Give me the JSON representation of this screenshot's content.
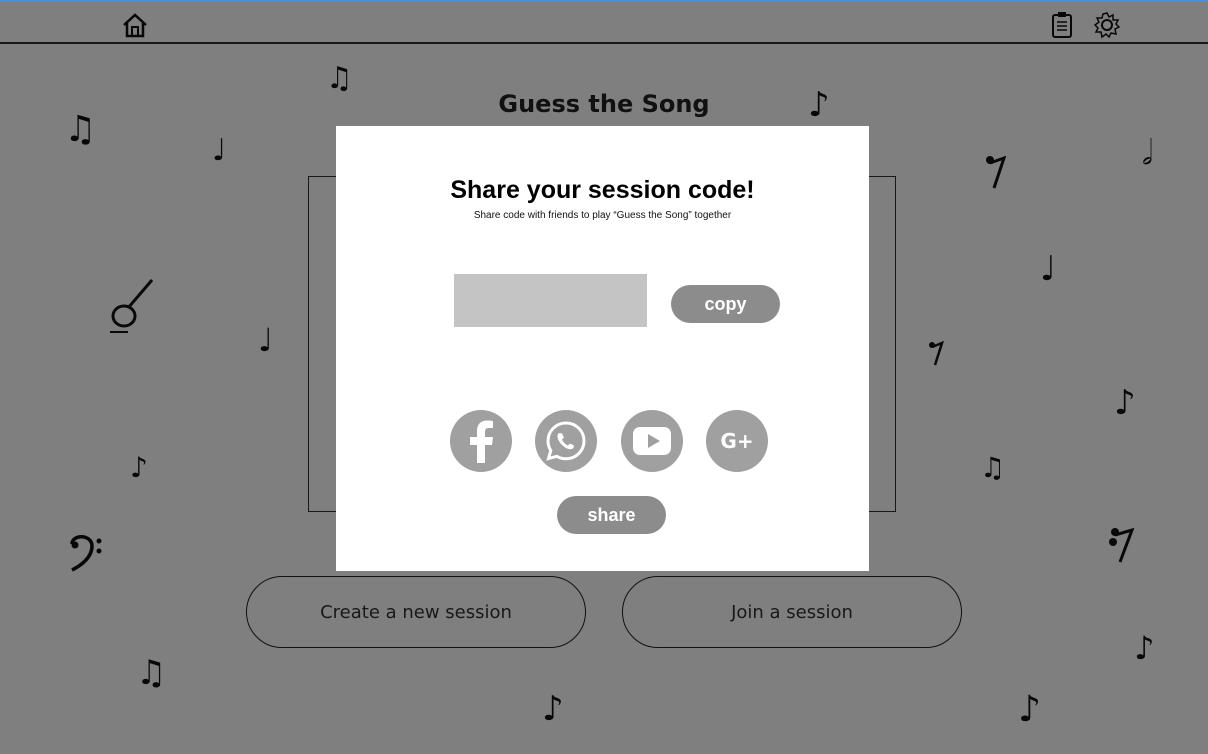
{
  "app": {
    "title": "Guess the Song",
    "topbar": {
      "home_icon": "home-icon",
      "clipboard_icon": "clipboard-icon",
      "settings_icon": "gear-icon"
    },
    "buttons": {
      "create_label": "Create a new session",
      "join_label": "Join a session"
    },
    "notes": [
      "♫",
      "♫",
      "♩",
      "𝅗𝅥",
      "♪",
      "♩",
      "♪",
      "♫",
      "♪",
      "♪",
      "♫",
      "♪",
      "♪",
      "♩",
      "𝅗𝅥",
      "♩",
      "♪",
      "♫"
    ]
  },
  "modal": {
    "title": "Share your session code!",
    "subtitle": "Share code with friends to play “Guess the Song” together",
    "code_value": "",
    "copy_label": "copy",
    "share_label": "share",
    "social": [
      {
        "icon": "facebook-icon",
        "glyph": "f"
      },
      {
        "icon": "whatsapp-icon",
        "glyph": ""
      },
      {
        "icon": "youtube-icon",
        "glyph": ""
      },
      {
        "icon": "google-plus-icon",
        "glyph": "G+"
      }
    ]
  },
  "colors": {
    "overlay": "#000000",
    "modal_bg": "#ffffff",
    "pill": "#8c8c8c",
    "social": "#a0a0a0",
    "code_field": "#c4c4c4",
    "top_accent": "#4a90d9"
  }
}
